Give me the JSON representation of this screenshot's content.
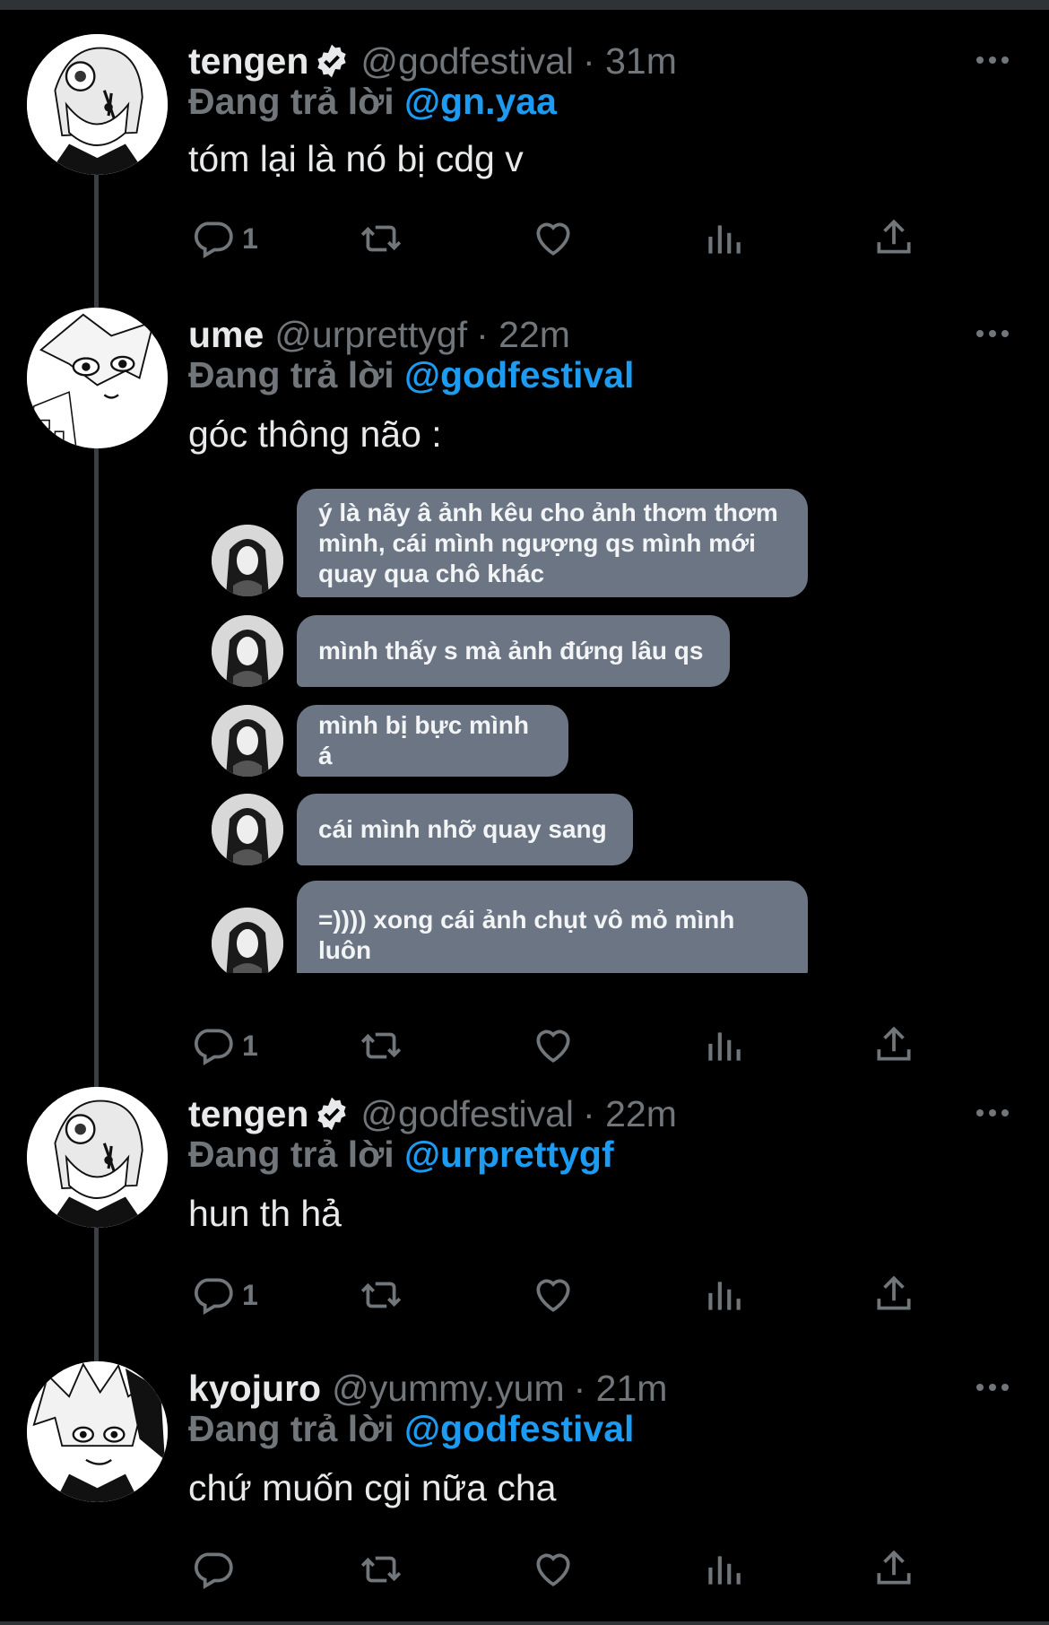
{
  "tweets": [
    {
      "name": "tengen",
      "verified": true,
      "handle": "@godfestival",
      "time": "· 31m",
      "reply_prefix": "Đang trả lời ",
      "reply_to": "@gn.yaa",
      "text": "tóm lại là nó bị cdg v",
      "reply_count": "1",
      "avatar": "tengen-avatar"
    },
    {
      "name": "ume",
      "verified": false,
      "handle": "@urprettygf",
      "time": "· 22m",
      "reply_prefix": "Đang trả lời ",
      "reply_to": "@godfestival",
      "text": "góc thông não :",
      "reply_count": "1",
      "avatar": "ume-avatar"
    },
    {
      "name": "tengen",
      "verified": true,
      "handle": "@godfestival",
      "time": "· 22m",
      "reply_prefix": "Đang trả lời ",
      "reply_to": "@urprettygf",
      "text": "hun th hả",
      "reply_count": "1",
      "avatar": "tengen-avatar"
    },
    {
      "name": "kyojuro",
      "verified": false,
      "handle": "@yummy.yum",
      "time": "· 21m",
      "reply_prefix": "Đang trả lời ",
      "reply_to": "@godfestival",
      "text": "chứ muốn cgi nữa cha",
      "reply_count": "",
      "avatar": "kyojuro-avatar"
    }
  ],
  "chat_messages": [
    "ý là nãy â ảnh kêu cho ảnh thơm thơm mình, cái mình ngượng qs mình mới quay qua chô khác",
    "mình thấy s mà ảnh đứng lâu qs",
    "mình bị bực mình á",
    "cái mình nhỡ quay sang",
    "=)))) xong cái ảnh chụt vô mỏ mình luôn"
  ],
  "colors": {
    "background": "#000000",
    "mention": "#1d9bf0",
    "muted": "#71767b",
    "bubble": "#6b7584"
  },
  "icons": [
    "reply-icon",
    "retweet-icon",
    "like-icon",
    "views-icon",
    "share-icon",
    "more-icon",
    "verified-badge-icon"
  ]
}
